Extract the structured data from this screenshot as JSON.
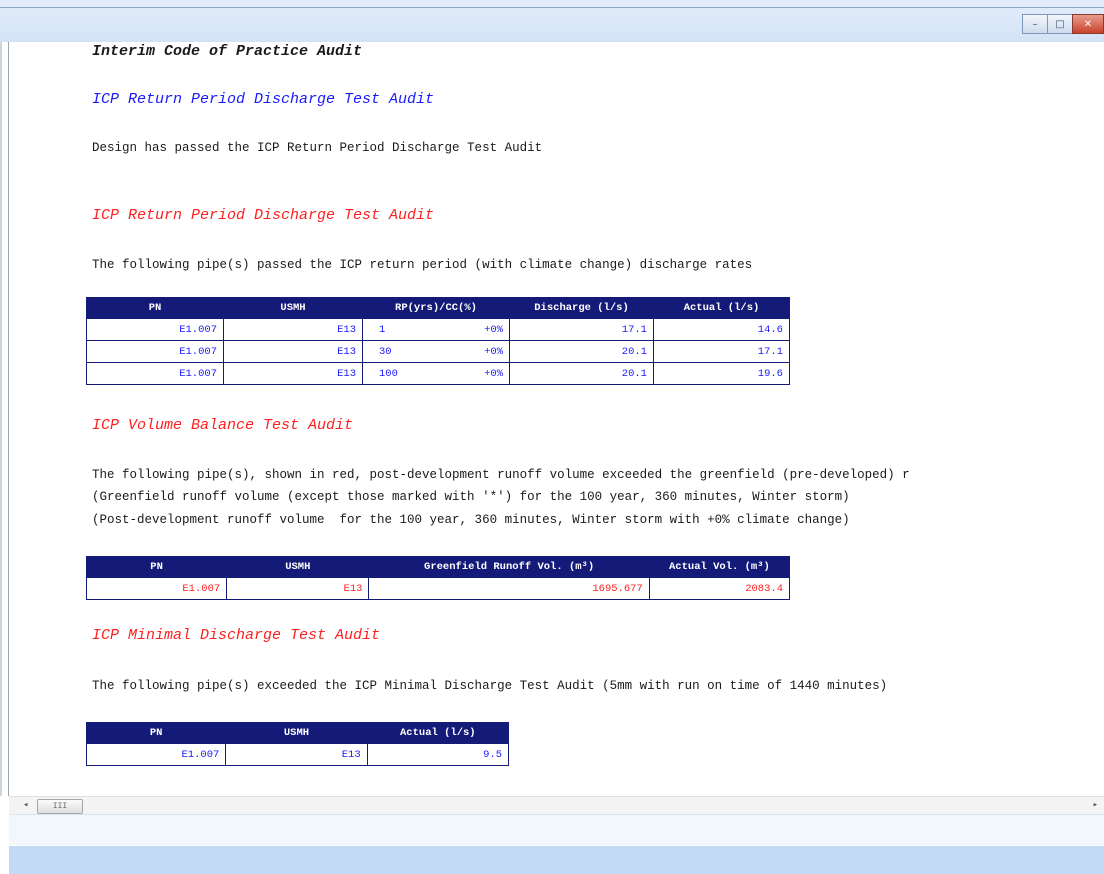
{
  "window": {
    "buttons": {
      "minimize": "–",
      "maximize": "□",
      "close": "✕"
    }
  },
  "document": {
    "title": "Interim Code of Practice Audit",
    "sections": [
      {
        "heading": "ICP Return Period Discharge Test Audit",
        "color": "#1a1aff",
        "text": "Design has passed the ICP Return Period Discharge Test Audit"
      },
      {
        "heading": "ICP Return Period Discharge Test Audit",
        "color": "#ff2020",
        "text": "The following pipe(s) passed the ICP return period (with climate change) discharge rates",
        "table": {
          "headers": [
            "PN",
            "USMH",
            "RP(yrs)/CC(%)",
            "Discharge (l/s)",
            "Actual (l/s)"
          ],
          "rows": [
            {
              "pn": "E1.007",
              "usmh": "E13",
              "rp": "1",
              "cc": "+0%",
              "discharge": "17.1",
              "actual": "14.6"
            },
            {
              "pn": "E1.007",
              "usmh": "E13",
              "rp": "30",
              "cc": "+0%",
              "discharge": "20.1",
              "actual": "17.1"
            },
            {
              "pn": "E1.007",
              "usmh": "E13",
              "rp": "100",
              "cc": "+0%",
              "discharge": "20.1",
              "actual": "19.6"
            }
          ]
        }
      },
      {
        "heading": "ICP Volume Balance Test Audit",
        "color": "#ff2020",
        "lines": [
          "The following pipe(s), shown in red, post-development runoff volume exceeded the greenfield (pre-developed) r",
          "(Greenfield runoff volume (except those marked with '*') for the 100 year, 360 minutes, Winter storm)",
          "(Post-development runoff volume  for the 100 year, 360 minutes, Winter storm with +0% climate change)"
        ],
        "table": {
          "headers": [
            "PN",
            "USMH",
            "Greenfield Runoff Vol. (m³)",
            "Actual Vol. (m³)"
          ],
          "rows": [
            {
              "pn": "E1.007",
              "usmh": "E13",
              "greenfield": "1695.677",
              "actual": "2083.4"
            }
          ]
        }
      },
      {
        "heading": "ICP Minimal Discharge Test Audit",
        "color": "#ff2020",
        "text": "The following pipe(s) exceeded the ICP Minimal Discharge Test Audit (5mm with run on time of 1440 minutes)",
        "table": {
          "headers": [
            "PN",
            "USMH",
            "Actual (l/s)"
          ],
          "rows": [
            {
              "pn": "E1.007",
              "usmh": "E13",
              "actual": "9.5"
            }
          ]
        }
      }
    ]
  },
  "scrollbar": {
    "left_arrow": "◂",
    "thumb": "III",
    "right_arrow": "▸"
  }
}
